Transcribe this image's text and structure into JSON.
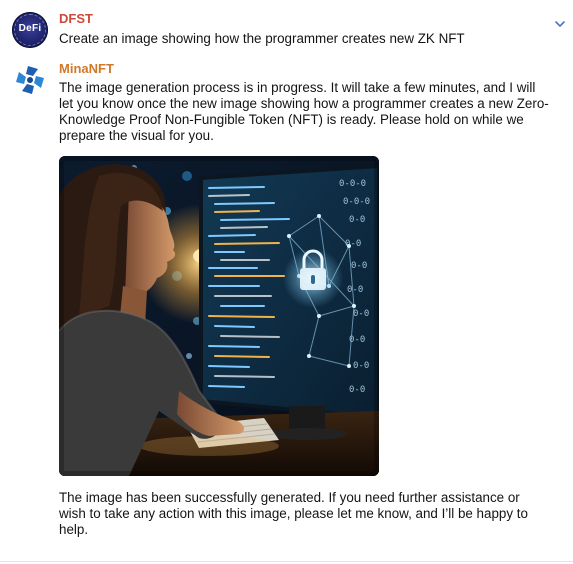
{
  "messages": [
    {
      "sender": "DFST",
      "avatar_label": "DeFi",
      "avatar_icon": "defi-logo-icon",
      "text": "Create an image showing how the programmer creates new ZK NFT"
    },
    {
      "sender": "MinaNFT",
      "avatar_icon": "mina-logo-icon",
      "text": "The image generation process is in progress. It will take a few minutes, and I will let you know once the new image showing how a programmer creates a new Zero-Knowledge Proof Non-Fungible Token (NFT) is ready. Please hold on while we prepare the visual for you.",
      "image_icon": "generated-image-programmer-zk-nft",
      "followup": "The image has been successfully generated. If you need further assistance or wish to take any action with this image, please let me know, and I’ll be happy to help."
    }
  ],
  "colors": {
    "user_name": "#cc4a3c",
    "bot_name": "#d0792b",
    "chevron": "#4a78c8"
  },
  "icons": {
    "collapse": "chevron-down-icon"
  }
}
